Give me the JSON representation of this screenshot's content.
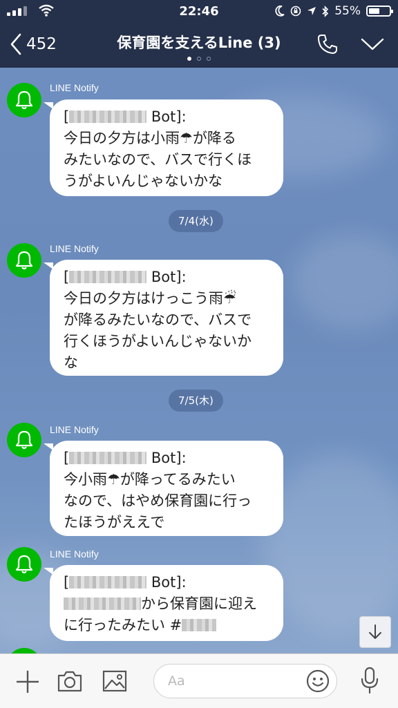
{
  "status_bar": {
    "time": "22:46",
    "battery_percent": "55%",
    "battery_level": 0.55
  },
  "header": {
    "back_count": "452",
    "title": "保育園を支えるLine (3)",
    "page_dots": 3,
    "active_dot": 0
  },
  "messages": [
    {
      "sender": "LINE Notify",
      "bot_suffix": "Bot]:",
      "body_lines": [
        "今日の夕方は小雨☂が降る",
        "みたいなので、バスで行くほ",
        "うがよいんじゃないかな"
      ]
    },
    {
      "date": "7/4(水)"
    },
    {
      "sender": "LINE Notify",
      "bot_suffix": "Bot]:",
      "body_lines": [
        "今日の夕方はけっこう雨☔",
        "が降るみたいなので、バスで",
        "行くほうがよいんじゃないか",
        "な"
      ]
    },
    {
      "date": "7/5(木)"
    },
    {
      "sender": "LINE Notify",
      "bot_suffix": "Bot]:",
      "body_lines": [
        "今小雨☂が降ってるみたい",
        "なので、はやめ保育園に行っ",
        "たほうがええで"
      ]
    },
    {
      "sender": "LINE Notify",
      "bot_suffix": "Bot]:",
      "body_lines": [
        "から保育園に迎え",
        "に行ったみたい #"
      ]
    }
  ],
  "input": {
    "placeholder": "Aa"
  },
  "icons": {
    "avatar": "bell-icon",
    "back": "chevron-left-icon",
    "call": "phone-icon",
    "menu": "chevron-down-icon",
    "add": "plus-icon",
    "camera": "camera-icon",
    "image": "image-icon",
    "emoji": "smiley-icon",
    "mic": "microphone-icon",
    "scroll": "arrow-down-icon"
  },
  "colors": {
    "header_bg": "#25304a",
    "avatar_green": "#00b900",
    "chat_bg": "#6f8fbf"
  }
}
